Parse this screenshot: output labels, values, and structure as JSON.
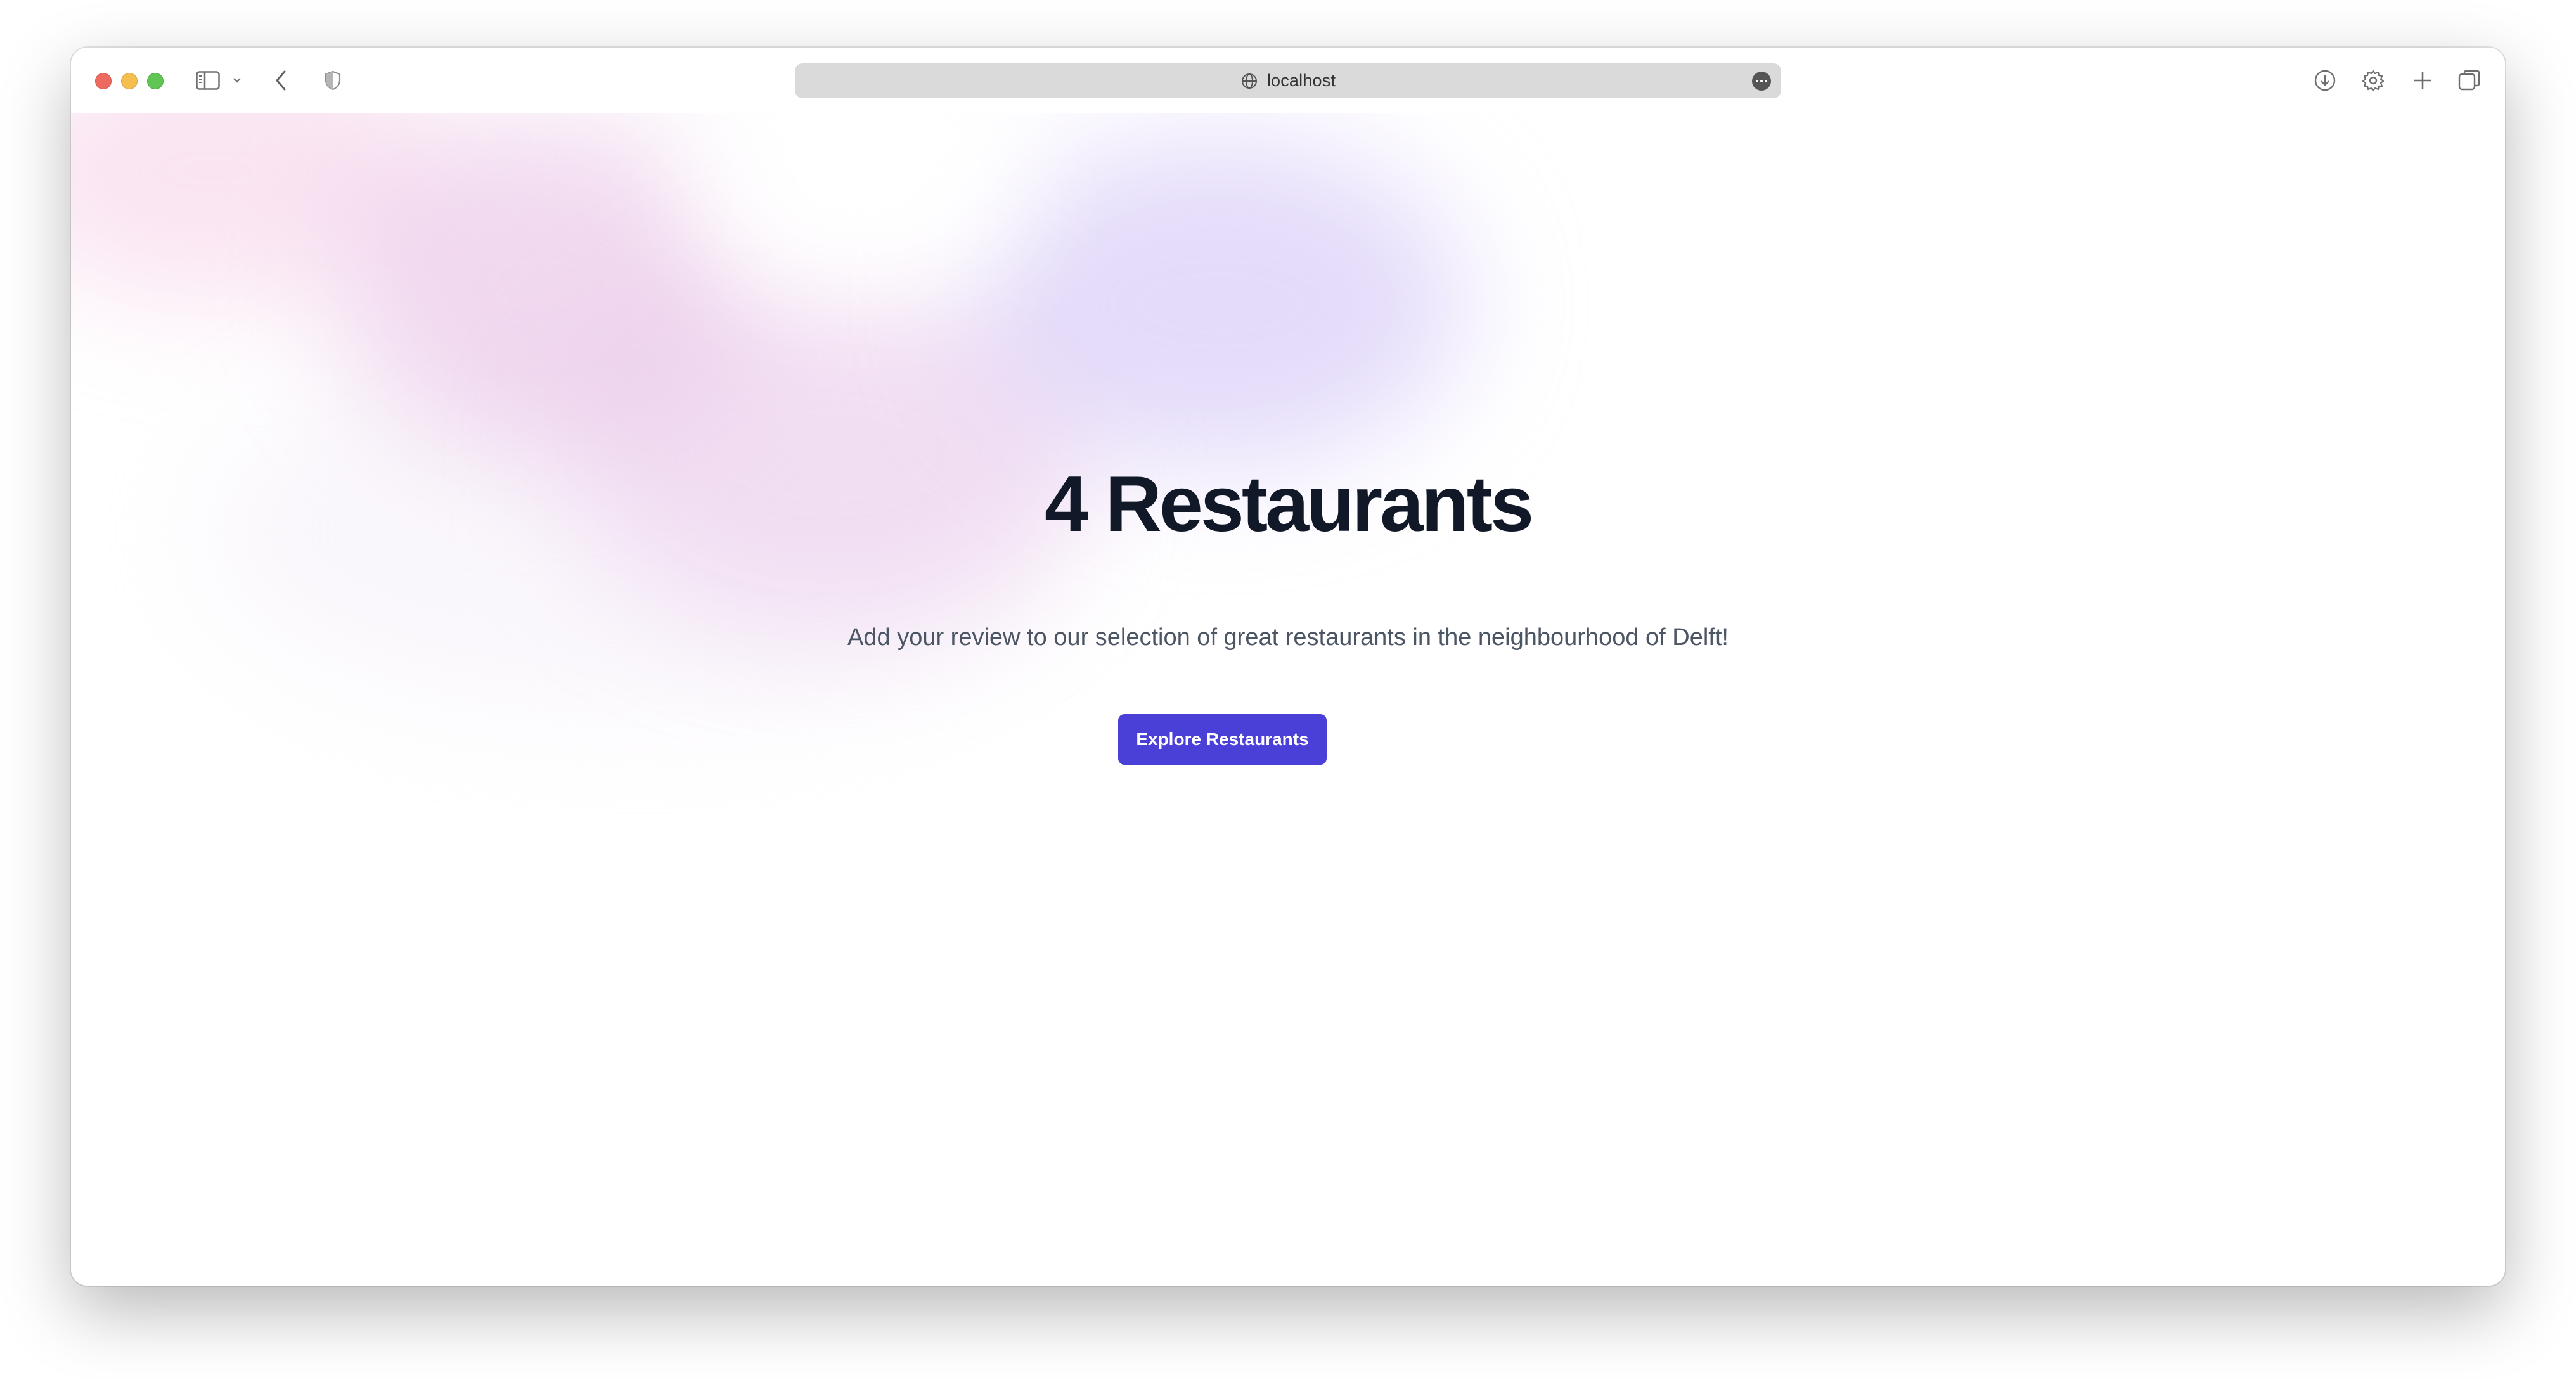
{
  "browser": {
    "address": "localhost"
  },
  "icons": {
    "sidebar": "sidebar-icon",
    "chevron": "chevron-down-icon",
    "back": "back-arrow-icon",
    "privacy": "privacy-shield-icon",
    "globe": "globe-icon",
    "page_menu": "more-icon",
    "download": "download-icon",
    "settings": "gear-icon",
    "new_tab": "plus-icon",
    "tabs": "tab-overview-icon"
  },
  "hero": {
    "title": "4 Restaurants",
    "subtitle": "Add your review to our selection of great restaurants in the neighbourhood of Delft!",
    "cta_label": "Explore Restaurants"
  },
  "colors": {
    "accent": "#4a3fd6",
    "title": "#111827",
    "subtitle": "#4b5563"
  }
}
